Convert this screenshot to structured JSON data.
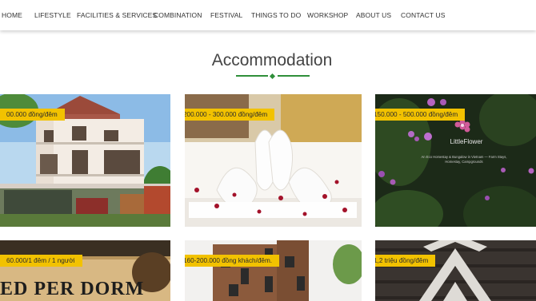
{
  "nav": {
    "items": [
      {
        "label": "HOME"
      },
      {
        "label": "LIFESTYLE"
      },
      {
        "label": "FACILITIES & SERVICES"
      },
      {
        "label": "COMBINATION"
      },
      {
        "label": "FESTIVAL"
      },
      {
        "label": "THINGS TO DO"
      },
      {
        "label": "WORKSHOP"
      },
      {
        "label": "ABOUT US"
      },
      {
        "label": "CONTACT US"
      }
    ]
  },
  "section": {
    "title": "Accommodation"
  },
  "cards": [
    {
      "price": "00.000 đồng/đêm"
    },
    {
      "price": "200.000 - 300.000 đồng/đêm"
    },
    {
      "price": "150.000 - 500.000 đồng/đêm",
      "logo_name": "LittleFlower",
      "logo_sub": "An Eco Homestay & Bungalow in Vietnam — Farm Stays, Homestay, Campgrounds"
    },
    {
      "price": "60.000/1 đêm / 1 người",
      "sign_text": "ED PER DORM"
    },
    {
      "price": "160-200.000 đồng khách/đêm."
    },
    {
      "price": "1,2 triệu đồng/đêm"
    }
  ],
  "colors": {
    "accent": "#2f8f3a",
    "badge": "#f2c200"
  }
}
